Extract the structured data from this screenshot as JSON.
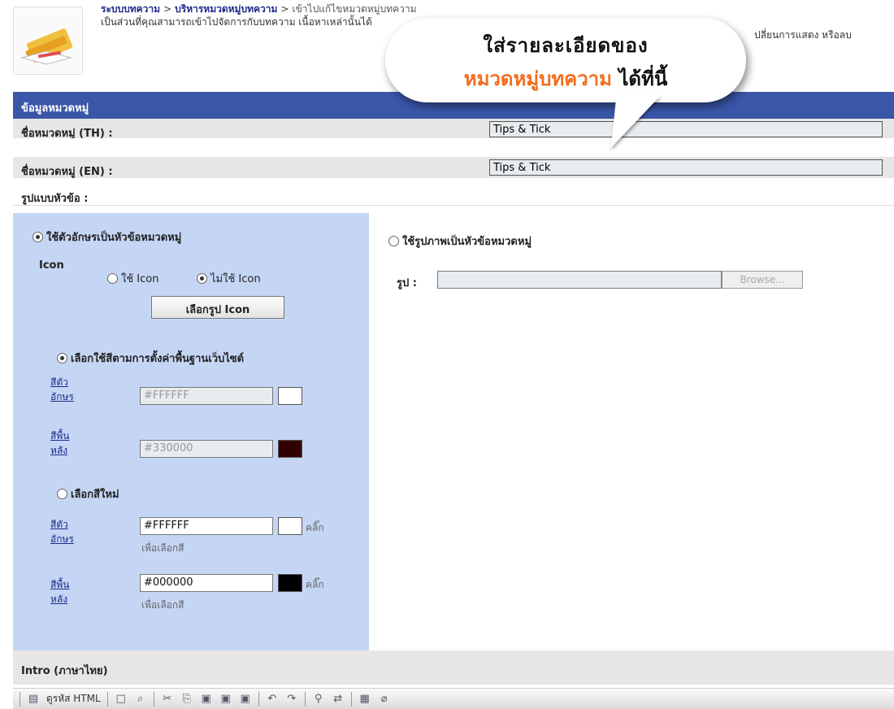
{
  "header": {
    "breadcrumb": [
      "ระบบบทความ",
      "บริหารหมวดหมู่บทความ",
      "เข้าไปแก้ไขหมวดหมู่บทความ"
    ],
    "description_left": "เป็นส่วนที่คุณสามารถเข้าไปจัดการกับบทความ เนื้อหาเหล่านั้นได้",
    "description_right": "ปลี่ยนการแสดง หรือลบ"
  },
  "callout": {
    "line1": "ใส่รายละเอียดของ",
    "highlight": "หมวดหมู่บทความ",
    "line2_rest": " ได้ที่นี้"
  },
  "section_title": "ข้อมูลหมวดหมู่",
  "fields": {
    "name_th_label": "ชื่อหมวดหมู่ (TH) :",
    "name_th_value": "Tips & Tick",
    "name_en_label": "ชื่อหมวดหมู่ (EN) :",
    "name_en_value": "Tips & Tick",
    "heading_style_label": "รูปแบบหัวข้อ :"
  },
  "text_option": {
    "label": "ใช้ตัวอักษรเป็นหัวข้อหมวดหมู่",
    "icon_label": "Icon",
    "use_icon": "ใช้ Icon",
    "no_icon": "ไม่ใช้ Icon",
    "choose_icon_button": "เลือกรูป Icon",
    "default_color_label": "เลือกใช้สีตามการตั้งค่าพื้นฐานเว็บไซต์",
    "font_color_link": "สีตัว อักษร",
    "bg_color_link": "สีพื้น หลัง",
    "default_font_color": "#FFFFFF",
    "default_bg_color": "#330000",
    "new_color_label": "เลือกสีใหม่",
    "new_font_color": "#FFFFFF",
    "new_bg_color": "#000000",
    "click_text": "คลิ๊ก",
    "pick_color_text": "เพื่อเลือกสี"
  },
  "image_option": {
    "label": "ใช้รูปภาพเป็นหัวข้อหมวดหมู่",
    "image_label": "รูป :",
    "browse_button": "Browse..."
  },
  "intro_label": "Intro (ภาษาไทย)",
  "toolbar": {
    "source_button": "ดูรหัส HTML"
  },
  "colors": {
    "accent_bar": "#3a56a8",
    "panel_bg": "#c5d6f5",
    "callout_highlight": "#f26d1d"
  }
}
